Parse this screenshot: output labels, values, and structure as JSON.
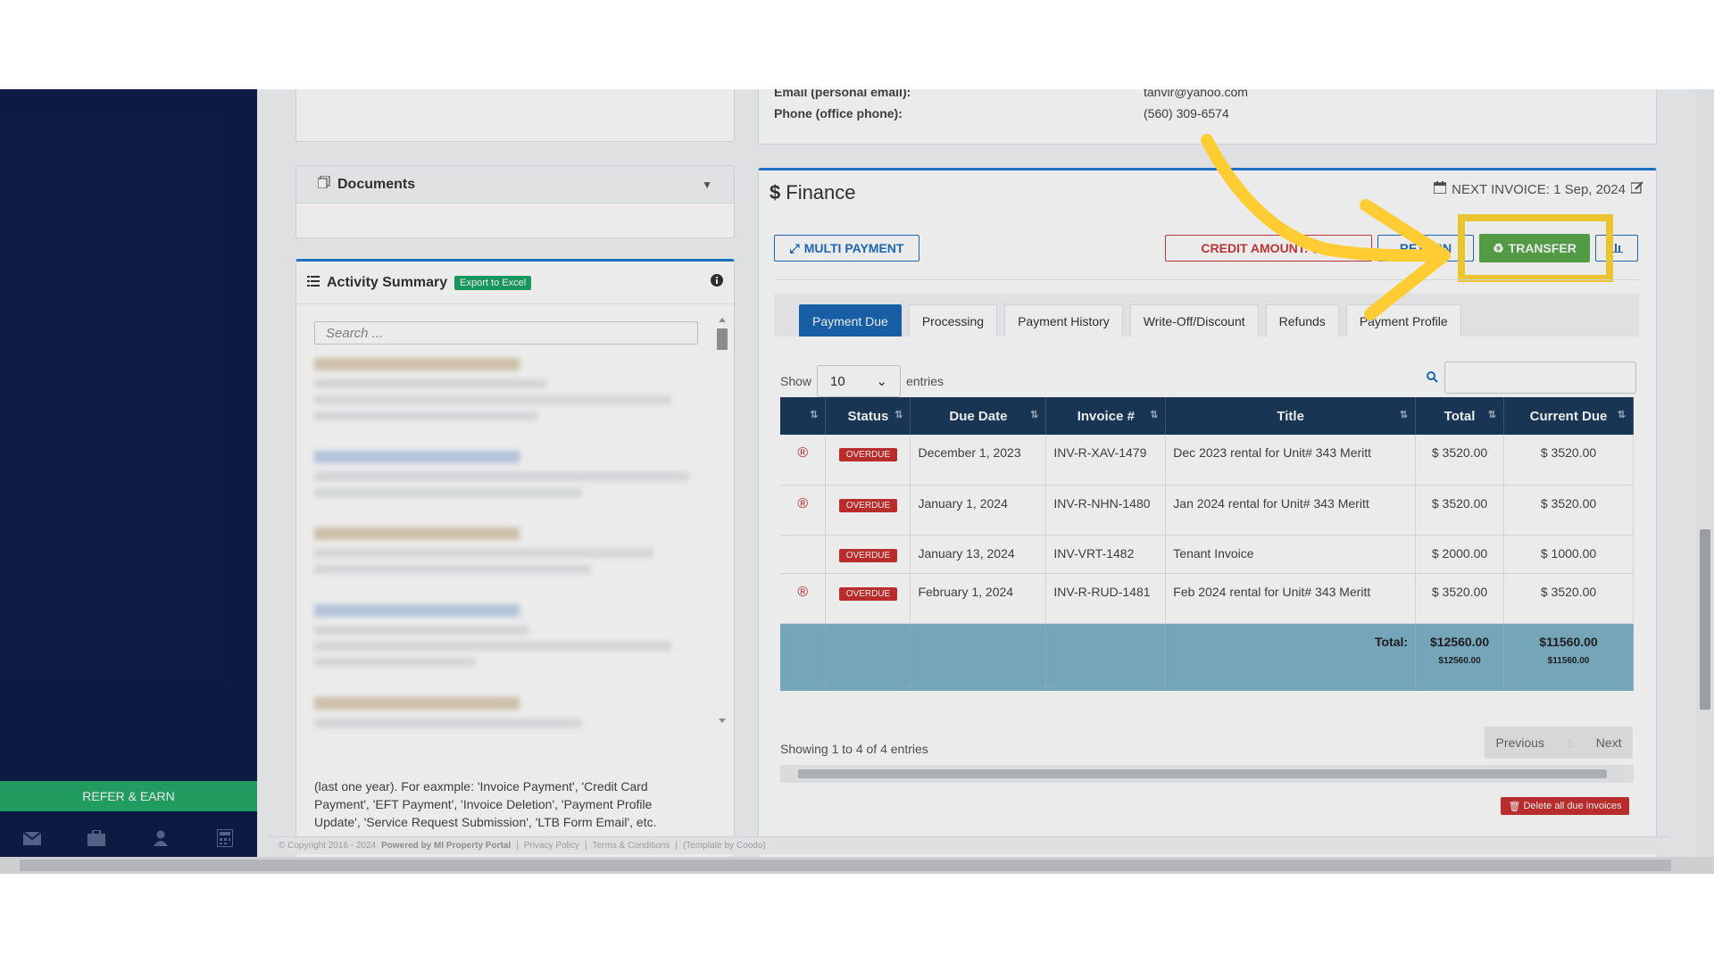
{
  "sidebar": {
    "refer_label": "REFER & EARN"
  },
  "contact": {
    "email_label": "Email (personal email):",
    "email_value": "tanvir@yahoo.com",
    "phone_label": "Phone (office phone):",
    "phone_value": "(560) 309-6574"
  },
  "documents": {
    "title": "Documents"
  },
  "activity": {
    "title": "Activity Summary",
    "export_label": "Export to Excel",
    "search_placeholder": "Search ...",
    "footer_text": "(last one year). For eaxmple: 'Invoice Payment', 'Credit Card Payment', 'EFT Payment', 'Invoice Deletion', 'Payment Profile Update', 'Service Request Submission', 'LTB Form Email', etc."
  },
  "finance": {
    "title": "Finance",
    "next_invoice": "NEXT INVOICE: 1 Sep, 2024",
    "buttons": {
      "multi_payment": "MULTI PAYMENT",
      "credit_amount": "CREDIT AMOUNT: $2...",
      "return": "RETURN",
      "transfer": "TRANSFER"
    },
    "tabs": [
      "Payment Due",
      "Processing",
      "Payment History",
      "Write-Off/Discount",
      "Refunds",
      "Payment Profile"
    ],
    "show_label": "Show",
    "entries_value": "10",
    "entries_label": "entries",
    "columns": [
      "",
      "Status",
      "Due Date",
      "Invoice #",
      "Title",
      "Total",
      "Current Due"
    ],
    "rows": [
      {
        "status": "OVERDUE",
        "due_date": "December 1, 2023",
        "invoice": "INV-R-XAV-1479",
        "title": "Dec 2023 rental for Unit# 343 Meritt",
        "total": "$ 3520.00",
        "current_due": "$ 3520.00",
        "flag": "®"
      },
      {
        "status": "OVERDUE",
        "due_date": "January 1, 2024",
        "invoice": "INV-R-NHN-1480",
        "title": "Jan 2024 rental for Unit# 343 Meritt",
        "total": "$ 3520.00",
        "current_due": "$ 3520.00",
        "flag": "®"
      },
      {
        "status": "OVERDUE",
        "due_date": "January 13, 2024",
        "invoice": "INV-VRT-1482",
        "title": "Tenant Invoice",
        "total": "$ 2000.00",
        "current_due": "$ 1000.00",
        "flag": ""
      },
      {
        "status": "OVERDUE",
        "due_date": "February 1, 2024",
        "invoice": "INV-R-RUD-1481",
        "title": "Feb 2024 rental for Unit# 343 Meritt",
        "total": "$ 3520.00",
        "current_due": "$ 3520.00",
        "flag": "®"
      }
    ],
    "totals": {
      "label": "Total:",
      "total": "$12560.00",
      "current_due": "$11560.00",
      "total_small": "$12560.00",
      "current_due_small": "$11560.00"
    },
    "showing": "Showing 1 to 4 of 4 entries",
    "pager": {
      "previous": "Previous",
      "page": "1",
      "next": "Next"
    },
    "delete_all": "Delete all due invoices"
  },
  "footer": {
    "copyright": "© Copyright 2016 - 2024",
    "powered": "Powered by MI Property Portal",
    "privacy": "Privacy Policy",
    "terms": "Terms & Conditions",
    "template": "(Template by Coodo)"
  },
  "colors": {
    "sidebar": "#0f1d49",
    "accent": "#1b67b3",
    "header": "#1b3a5c",
    "overdue": "#c8302f",
    "transfer": "#5aa84a",
    "highlight": "#ffd633"
  }
}
